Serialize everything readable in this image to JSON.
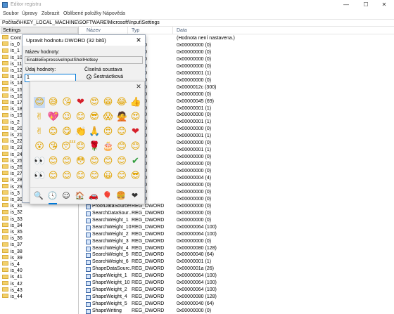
{
  "window": {
    "title": "Editor registru",
    "min": "—",
    "max": "☐",
    "close": "✕"
  },
  "menu": [
    "Soubor",
    "Úpravy",
    "Zobrazit",
    "Oblíbené položky",
    "Nápověda"
  ],
  "address": "Počítač\\HKEY_LOCAL_MACHINE\\SOFTWARE\\Microsoft\\Input\\Settings",
  "tree": {
    "header": "Settings",
    "items": [
      "Cont",
      "is_0",
      "is_1",
      "is_10",
      "is_11",
      "is_12",
      "is_13",
      "is_14",
      "is_15",
      "is_16",
      "is_17",
      "is_18",
      "is_19",
      "is_2",
      "is_20",
      "is_21",
      "is_22",
      "is_23",
      "is_24",
      "is_25",
      "is_26",
      "is_27",
      "is_28",
      "is_29",
      "is_3",
      "is_30",
      "is_31",
      "is_32",
      "is_33",
      "is_34",
      "is_35",
      "is_36",
      "is_37",
      "is_38",
      "is_39",
      "is_4",
      "is_40",
      "is_41",
      "is_42",
      "is_43",
      "is_44"
    ]
  },
  "list": {
    "headers": {
      "name": "Název",
      "type": "Typ",
      "data": "Data"
    },
    "rows": [
      {
        "name": "",
        "type": "",
        "data": "(Hodnota není nastavena.)"
      },
      {
        "name": "",
        "type": "WORD",
        "data": "0x00000000 (0)"
      },
      {
        "name": "",
        "type": "WORD",
        "data": "0x00000000 (0)"
      },
      {
        "name": "",
        "type": "WORD",
        "data": "0x00000000 (0)"
      },
      {
        "name": "",
        "type": "WORD",
        "data": "0x00000000 (0)"
      },
      {
        "name": "",
        "type": "WORD",
        "data": "0x00000001 (1)"
      },
      {
        "name": "",
        "type": "WORD",
        "data": "0x00000000 (0)"
      },
      {
        "name": "",
        "type": "WORD",
        "data": "0x0000012c (300)"
      },
      {
        "name": "",
        "type": "WORD",
        "data": "0x00000000 (0)"
      },
      {
        "name": "",
        "type": "WORD",
        "data": "0x00000045 (69)"
      },
      {
        "name": "",
        "type": "WORD",
        "data": "0x00000001 (1)"
      },
      {
        "name": "",
        "type": "WORD",
        "data": "0x00000000 (0)"
      },
      {
        "name": "",
        "type": "WORD",
        "data": "0x00000001 (1)"
      },
      {
        "name": "",
        "type": "WORD",
        "data": "0x00000000 (0)"
      },
      {
        "name": "",
        "type": "WORD",
        "data": "0x00000001 (1)"
      },
      {
        "name": "",
        "type": "WORD",
        "data": "0x00000000 (0)"
      },
      {
        "name": "",
        "type": "WORD",
        "data": "0x00000001 (1)"
      },
      {
        "name": "",
        "type": "WORD",
        "data": "0x00000000 (0)"
      },
      {
        "name": "",
        "type": "WORD",
        "data": "0x00000000 (0)"
      },
      {
        "name": "",
        "type": "WORD",
        "data": "0x00000000 (0)"
      },
      {
        "name": "",
        "type": "WORD",
        "data": "0x00000004 (4)"
      },
      {
        "name": "",
        "type": "WORD",
        "data": "0x00000000 (0)"
      },
      {
        "name": "",
        "type": "WORD",
        "data": "0x00000000 (0)"
      },
      {
        "name": "",
        "type": "WORD",
        "data": "0x00000000 (0)"
      },
      {
        "name": "ProofDataSources",
        "type": "REG_DWORD",
        "data": "0x00000000 (0)"
      },
      {
        "name": "SearchDataSour...",
        "type": "REG_DWORD",
        "data": "0x00000000 (0)"
      },
      {
        "name": "SearchWeight_1",
        "type": "REG_DWORD",
        "data": "0x00000000 (0)"
      },
      {
        "name": "SearchWeight_10",
        "type": "REG_DWORD",
        "data": "0x00000064 (100)"
      },
      {
        "name": "SearchWeight_2",
        "type": "REG_DWORD",
        "data": "0x00000064 (100)"
      },
      {
        "name": "SearchWeight_3",
        "type": "REG_DWORD",
        "data": "0x00000000 (0)"
      },
      {
        "name": "SearchWeight_4",
        "type": "REG_DWORD",
        "data": "0x00000080 (128)"
      },
      {
        "name": "SearchWeight_5",
        "type": "REG_DWORD",
        "data": "0x00000040 (64)"
      },
      {
        "name": "SearchWeight_6",
        "type": "REG_DWORD",
        "data": "0x00000001 (1)"
      },
      {
        "name": "ShapeDataSourc...",
        "type": "REG_DWORD",
        "data": "0x0000001a (26)"
      },
      {
        "name": "ShapeWeight_1",
        "type": "REG_DWORD",
        "data": "0x00000064 (100)"
      },
      {
        "name": "ShapeWeight_10",
        "type": "REG_DWORD",
        "data": "0x00000064 (100)"
      },
      {
        "name": "ShapeWeight_2",
        "type": "REG_DWORD",
        "data": "0x00000064 (100)"
      },
      {
        "name": "ShapeWeight_4",
        "type": "REG_DWORD",
        "data": "0x00000080 (128)"
      },
      {
        "name": "ShapeWeight_5",
        "type": "REG_DWORD",
        "data": "0x00000040 (64)"
      },
      {
        "name": "ShapeWriting",
        "type": "REG_DWORD",
        "data": "0x00000000 (0)"
      }
    ]
  },
  "dialog": {
    "title": "Upravit hodnotu DWORD (32 bitů)",
    "close": "✕",
    "name_label": "Název hodnoty:",
    "name_value": "EnableExpressiveInputShellHotkey",
    "data_label": "Údaj hodnoty:",
    "data_value": "1",
    "base_label": "Číselná soustava",
    "base_option": "Šestnáctková"
  },
  "emoji_panel": {
    "close": "✕",
    "grid": [
      [
        "😊",
        "😅",
        "😘",
        "❤",
        "😍",
        "😁",
        "😂",
        "👍"
      ],
      [
        "✌",
        "💖",
        "😉",
        "😊",
        "😎",
        "😱",
        "🙅",
        "😍"
      ],
      [
        "✌",
        "😊",
        "😋",
        "👏",
        "🙏",
        "😍",
        "😊",
        "❤"
      ],
      [
        "😮",
        "😘",
        "😴",
        "😊",
        "🌹",
        "🎂",
        "😊",
        "😊"
      ],
      [
        "👀",
        "😊",
        "😊",
        "😳",
        "😊",
        "😊",
        "😊",
        "✔"
      ],
      [
        "👀",
        "😊",
        "😊",
        "😊",
        "😊",
        "😀",
        "😊",
        "😎"
      ]
    ],
    "tabs": [
      "🔍",
      "🕓",
      "☺",
      "🏠",
      "🚗",
      "🎈",
      "🍔",
      "❤"
    ],
    "colors": {
      "accent": "#0078d7",
      "emoji_yellow": "#e1a300",
      "heart_red": "#d6202a"
    }
  }
}
